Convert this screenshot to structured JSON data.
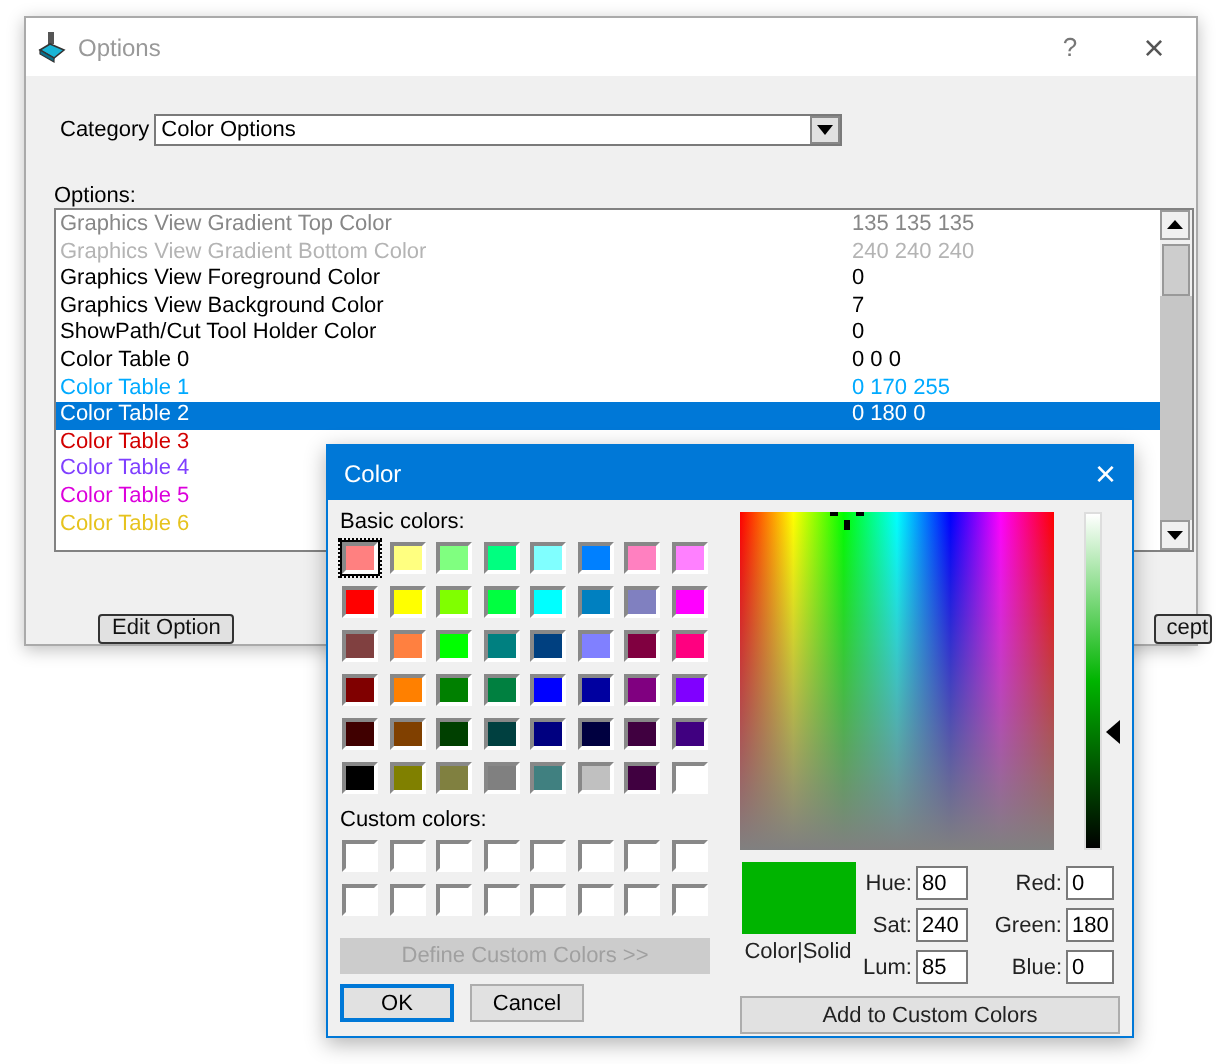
{
  "window": {
    "title": "Options",
    "help": "?",
    "close": "×"
  },
  "category": {
    "label": "Category",
    "value": "Color Options"
  },
  "options": {
    "label": "Options:",
    "rows": [
      {
        "name": "Graphics View Gradient Top Color",
        "value": "135 135 135",
        "color": "#878787",
        "selected": false
      },
      {
        "name": "Graphics View Gradient Bottom Color",
        "value": "240 240 240",
        "color": "#b4b4b4",
        "selected": false
      },
      {
        "name": "Graphics View Foreground Color",
        "value": "0",
        "color": "#000000",
        "selected": false
      },
      {
        "name": "Graphics View Background Color",
        "value": "7",
        "color": "#000000",
        "selected": false
      },
      {
        "name": "ShowPath/Cut Tool Holder Color",
        "value": "0",
        "color": "#000000",
        "selected": false
      },
      {
        "name": "Color Table 0",
        "value": "0 0 0",
        "color": "#000000",
        "selected": false
      },
      {
        "name": "Color Table 1",
        "value": "0 170 255",
        "color": "#00aaff",
        "selected": false
      },
      {
        "name": "Color Table 2",
        "value": "0 180 0",
        "selected": true
      },
      {
        "name": "Color Table 3",
        "color": "#d20000",
        "selected": false
      },
      {
        "name": "Color Table 4",
        "color": "#7f3fff",
        "selected": false
      },
      {
        "name": "Color Table 5",
        "color": "#dc00dc",
        "selected": false
      },
      {
        "name": "Color Table 6",
        "color": "#e6c31e",
        "selected": false
      }
    ]
  },
  "buttons": [
    {
      "label": "Edit Option"
    },
    {
      "label": "cept"
    }
  ],
  "color_dialog": {
    "title": "Color",
    "close": "×",
    "basic_label": "Basic colors:",
    "basic_colors": [
      {
        "color": "#ff8080",
        "selected": true
      },
      {
        "color": "#ffff80",
        "selected": false
      },
      {
        "color": "#80ff80",
        "selected": false
      },
      {
        "color": "#00ff80",
        "selected": false
      },
      {
        "color": "#80ffff",
        "selected": false
      },
      {
        "color": "#0080ff",
        "selected": false
      },
      {
        "color": "#ff80c0",
        "selected": false
      },
      {
        "color": "#ff80ff",
        "selected": false
      },
      {
        "color": "#ff0000",
        "selected": false
      },
      {
        "color": "#ffff00",
        "selected": false
      },
      {
        "color": "#80ff00",
        "selected": false
      },
      {
        "color": "#00ff40",
        "selected": false
      },
      {
        "color": "#00ffff",
        "selected": false
      },
      {
        "color": "#0080c0",
        "selected": false
      },
      {
        "color": "#8080c0",
        "selected": false
      },
      {
        "color": "#ff00ff",
        "selected": false
      },
      {
        "color": "#804040",
        "selected": false
      },
      {
        "color": "#ff8040",
        "selected": false
      },
      {
        "color": "#00ff00",
        "selected": false
      },
      {
        "color": "#008080",
        "selected": false
      },
      {
        "color": "#004080",
        "selected": false
      },
      {
        "color": "#8080ff",
        "selected": false
      },
      {
        "color": "#800040",
        "selected": false
      },
      {
        "color": "#ff0080",
        "selected": false
      },
      {
        "color": "#800000",
        "selected": false
      },
      {
        "color": "#ff8000",
        "selected": false
      },
      {
        "color": "#008000",
        "selected": false
      },
      {
        "color": "#008040",
        "selected": false
      },
      {
        "color": "#0000ff",
        "selected": false
      },
      {
        "color": "#0000a0",
        "selected": false
      },
      {
        "color": "#800080",
        "selected": false
      },
      {
        "color": "#8000ff",
        "selected": false
      },
      {
        "color": "#400000",
        "selected": false
      },
      {
        "color": "#804000",
        "selected": false
      },
      {
        "color": "#004000",
        "selected": false
      },
      {
        "color": "#004040",
        "selected": false
      },
      {
        "color": "#000080",
        "selected": false
      },
      {
        "color": "#000040",
        "selected": false
      },
      {
        "color": "#400040",
        "selected": false
      },
      {
        "color": "#400080",
        "selected": false
      },
      {
        "color": "#000000",
        "selected": false
      },
      {
        "color": "#808000",
        "selected": false
      },
      {
        "color": "#808040",
        "selected": false
      },
      {
        "color": "#808080",
        "selected": false
      },
      {
        "color": "#408080",
        "selected": false
      },
      {
        "color": "#c0c0c0",
        "selected": false
      },
      {
        "color": "#400040",
        "selected": false
      },
      {
        "color": "#ffffff",
        "selected": false
      }
    ],
    "custom_label": "Custom colors:",
    "custom_colors": [
      {
        "color": "#ffffff"
      },
      {
        "color": "#ffffff"
      },
      {
        "color": "#ffffff"
      },
      {
        "color": "#ffffff"
      },
      {
        "color": "#ffffff"
      },
      {
        "color": "#ffffff"
      },
      {
        "color": "#ffffff"
      },
      {
        "color": "#ffffff"
      },
      {
        "color": "#ffffff"
      },
      {
        "color": "#ffffff"
      },
      {
        "color": "#ffffff"
      },
      {
        "color": "#ffffff"
      },
      {
        "color": "#ffffff"
      },
      {
        "color": "#ffffff"
      },
      {
        "color": "#ffffff"
      },
      {
        "color": "#ffffff"
      }
    ],
    "define_button": {
      "label": "Define Custom Colors >>",
      "disabled": true
    },
    "ok_button": {
      "label": "OK"
    },
    "cancel_button": {
      "label": "Cancel"
    },
    "luminance": {
      "level": 0.35
    },
    "preview": {
      "color": "#00b400",
      "label": "Color|Solid"
    },
    "fields": [
      {
        "label": "Hue:",
        "value": "80"
      },
      {
        "label": "Red:",
        "value": "0"
      },
      {
        "label": "Sat:",
        "value": "240"
      },
      {
        "label": "Green:",
        "value": "180"
      },
      {
        "label": "Lum:",
        "value": "85"
      },
      {
        "label": "Blue:",
        "value": "0"
      }
    ],
    "add_button": {
      "label": "Add to Custom Colors"
    }
  }
}
